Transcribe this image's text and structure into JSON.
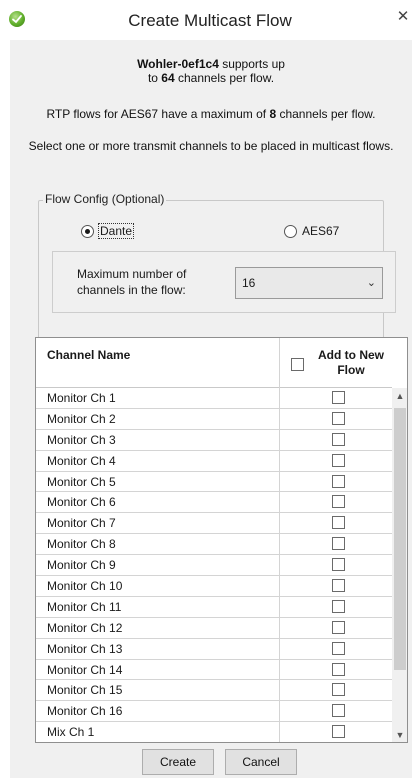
{
  "window": {
    "title": "Create Multicast Flow",
    "close_glyph": "✕"
  },
  "info": {
    "device_name": "Wohler-0ef1c4",
    "supports_text": " supports up",
    "line2_prefix": "to ",
    "max_channels": "64",
    "line2_suffix": " channels per flow.",
    "aes67_prefix": "RTP flows for AES67 have a maximum of ",
    "aes67_max": "8",
    "aes67_suffix": " channels per flow.",
    "instruction": "Select one or more transmit channels to be placed in multicast flows."
  },
  "flow_config": {
    "legend": "Flow Config (Optional)",
    "options": [
      {
        "label": "Dante",
        "checked": true
      },
      {
        "label": "AES67",
        "checked": false
      }
    ],
    "max_label": "Maximum number of channels in the flow:",
    "max_value": "16",
    "arrow_glyph": "⌄"
  },
  "table": {
    "col_name": "Channel Name",
    "col_add": "Add to New Flow",
    "rows": [
      {
        "name": "Monitor Ch 1",
        "checked": false
      },
      {
        "name": "Monitor Ch 2",
        "checked": false
      },
      {
        "name": "Monitor Ch 3",
        "checked": false
      },
      {
        "name": "Monitor Ch 4",
        "checked": false
      },
      {
        "name": "Monitor Ch 5",
        "checked": false
      },
      {
        "name": "Monitor Ch 6",
        "checked": false
      },
      {
        "name": "Monitor Ch 7",
        "checked": false
      },
      {
        "name": "Monitor Ch 8",
        "checked": false
      },
      {
        "name": "Monitor Ch 9",
        "checked": false
      },
      {
        "name": "Monitor Ch 10",
        "checked": false
      },
      {
        "name": "Monitor Ch 11",
        "checked": false
      },
      {
        "name": "Monitor Ch 12",
        "checked": false
      },
      {
        "name": "Monitor Ch 13",
        "checked": false
      },
      {
        "name": "Monitor Ch 14",
        "checked": false
      },
      {
        "name": "Monitor Ch 15",
        "checked": false
      },
      {
        "name": "Monitor Ch 16",
        "checked": false
      },
      {
        "name": "Mix Ch 1",
        "checked": false
      }
    ],
    "scroll_up_glyph": "▲",
    "scroll_down_glyph": "▼"
  },
  "buttons": {
    "create": "Create",
    "cancel": "Cancel"
  }
}
